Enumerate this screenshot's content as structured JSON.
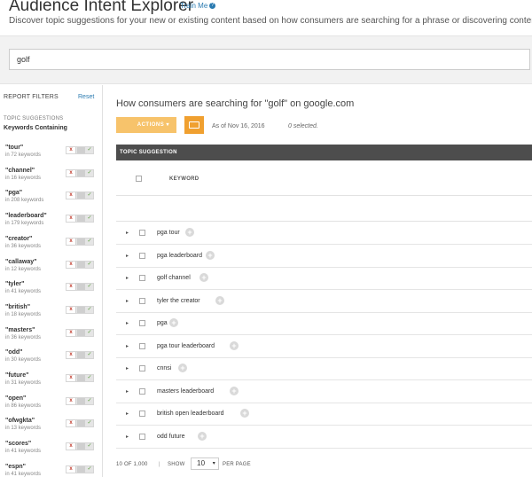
{
  "header": {
    "title": "Audience Intent Explorer",
    "train_me": "Train Me",
    "subtitle": "Discover topic suggestions for your new or existing content based on how consumers are searching for a phrase or discovering content"
  },
  "search": {
    "value": "golf"
  },
  "sidebar": {
    "header": "REPORT FILTERS",
    "reset": "Reset",
    "section": "TOPIC SUGGESTIONS",
    "subsection": "Keywords Containing",
    "filters": [
      {
        "keyword": "\"tour\"",
        "count": "in 72 keywords"
      },
      {
        "keyword": "\"channel\"",
        "count": "in 16 keywords"
      },
      {
        "keyword": "\"pga\"",
        "count": "in 208 keywords"
      },
      {
        "keyword": "\"leaderboard\"",
        "count": "in 179 keywords"
      },
      {
        "keyword": "\"creator\"",
        "count": "in 36 keywords"
      },
      {
        "keyword": "\"callaway\"",
        "count": "in 12 keywords"
      },
      {
        "keyword": "\"tyler\"",
        "count": "in 41 keywords"
      },
      {
        "keyword": "\"british\"",
        "count": "in 18 keywords"
      },
      {
        "keyword": "\"masters\"",
        "count": "in 36 keywords"
      },
      {
        "keyword": "\"odd\"",
        "count": "in 30 keywords"
      },
      {
        "keyword": "\"future\"",
        "count": "in 31 keywords"
      },
      {
        "keyword": "\"open\"",
        "count": "in 86 keywords"
      },
      {
        "keyword": "\"ofwgkta\"",
        "count": "in 13 keywords"
      },
      {
        "keyword": "\"scores\"",
        "count": "in 41 keywords"
      },
      {
        "keyword": "\"espn\"",
        "count": "in 41 keywords"
      }
    ]
  },
  "main": {
    "title": "How consumers are searching for \"golf\" on google.com",
    "actions_label": "ACTIONS",
    "as_of": "As of Nov 16, 2016",
    "selected": "0 selected.",
    "table_header": "TOPIC SUGGESTION",
    "column_keyword": "KEYWORD",
    "rows": [
      {
        "keyword": "pga tour"
      },
      {
        "keyword": "pga leaderboard"
      },
      {
        "keyword": "golf channel"
      },
      {
        "keyword": "tyler the creator"
      },
      {
        "keyword": "pga"
      },
      {
        "keyword": "pga tour leaderboard"
      },
      {
        "keyword": "cnnsi"
      },
      {
        "keyword": "masters leaderboard"
      },
      {
        "keyword": "british open leaderboard"
      },
      {
        "keyword": "odd future"
      }
    ],
    "pager": {
      "count": "10 OF 1,000",
      "separator": "|",
      "show": "SHOW",
      "per_page_value": "10",
      "per_page_label": "PER PAGE"
    }
  },
  "colors": {
    "accent_orange": "#f0a030",
    "actions_button": "#f7c36b",
    "table_header_bg": "#4d4d4d",
    "link_blue": "#2a7ab0"
  },
  "icons": {
    "train_me": "help-circle-icon",
    "export": "export-icon",
    "row_expand": "caret-right-icon",
    "row_add": "plus-circle-icon",
    "toggle_exclude": "x-icon",
    "toggle_include": "check-icon"
  }
}
